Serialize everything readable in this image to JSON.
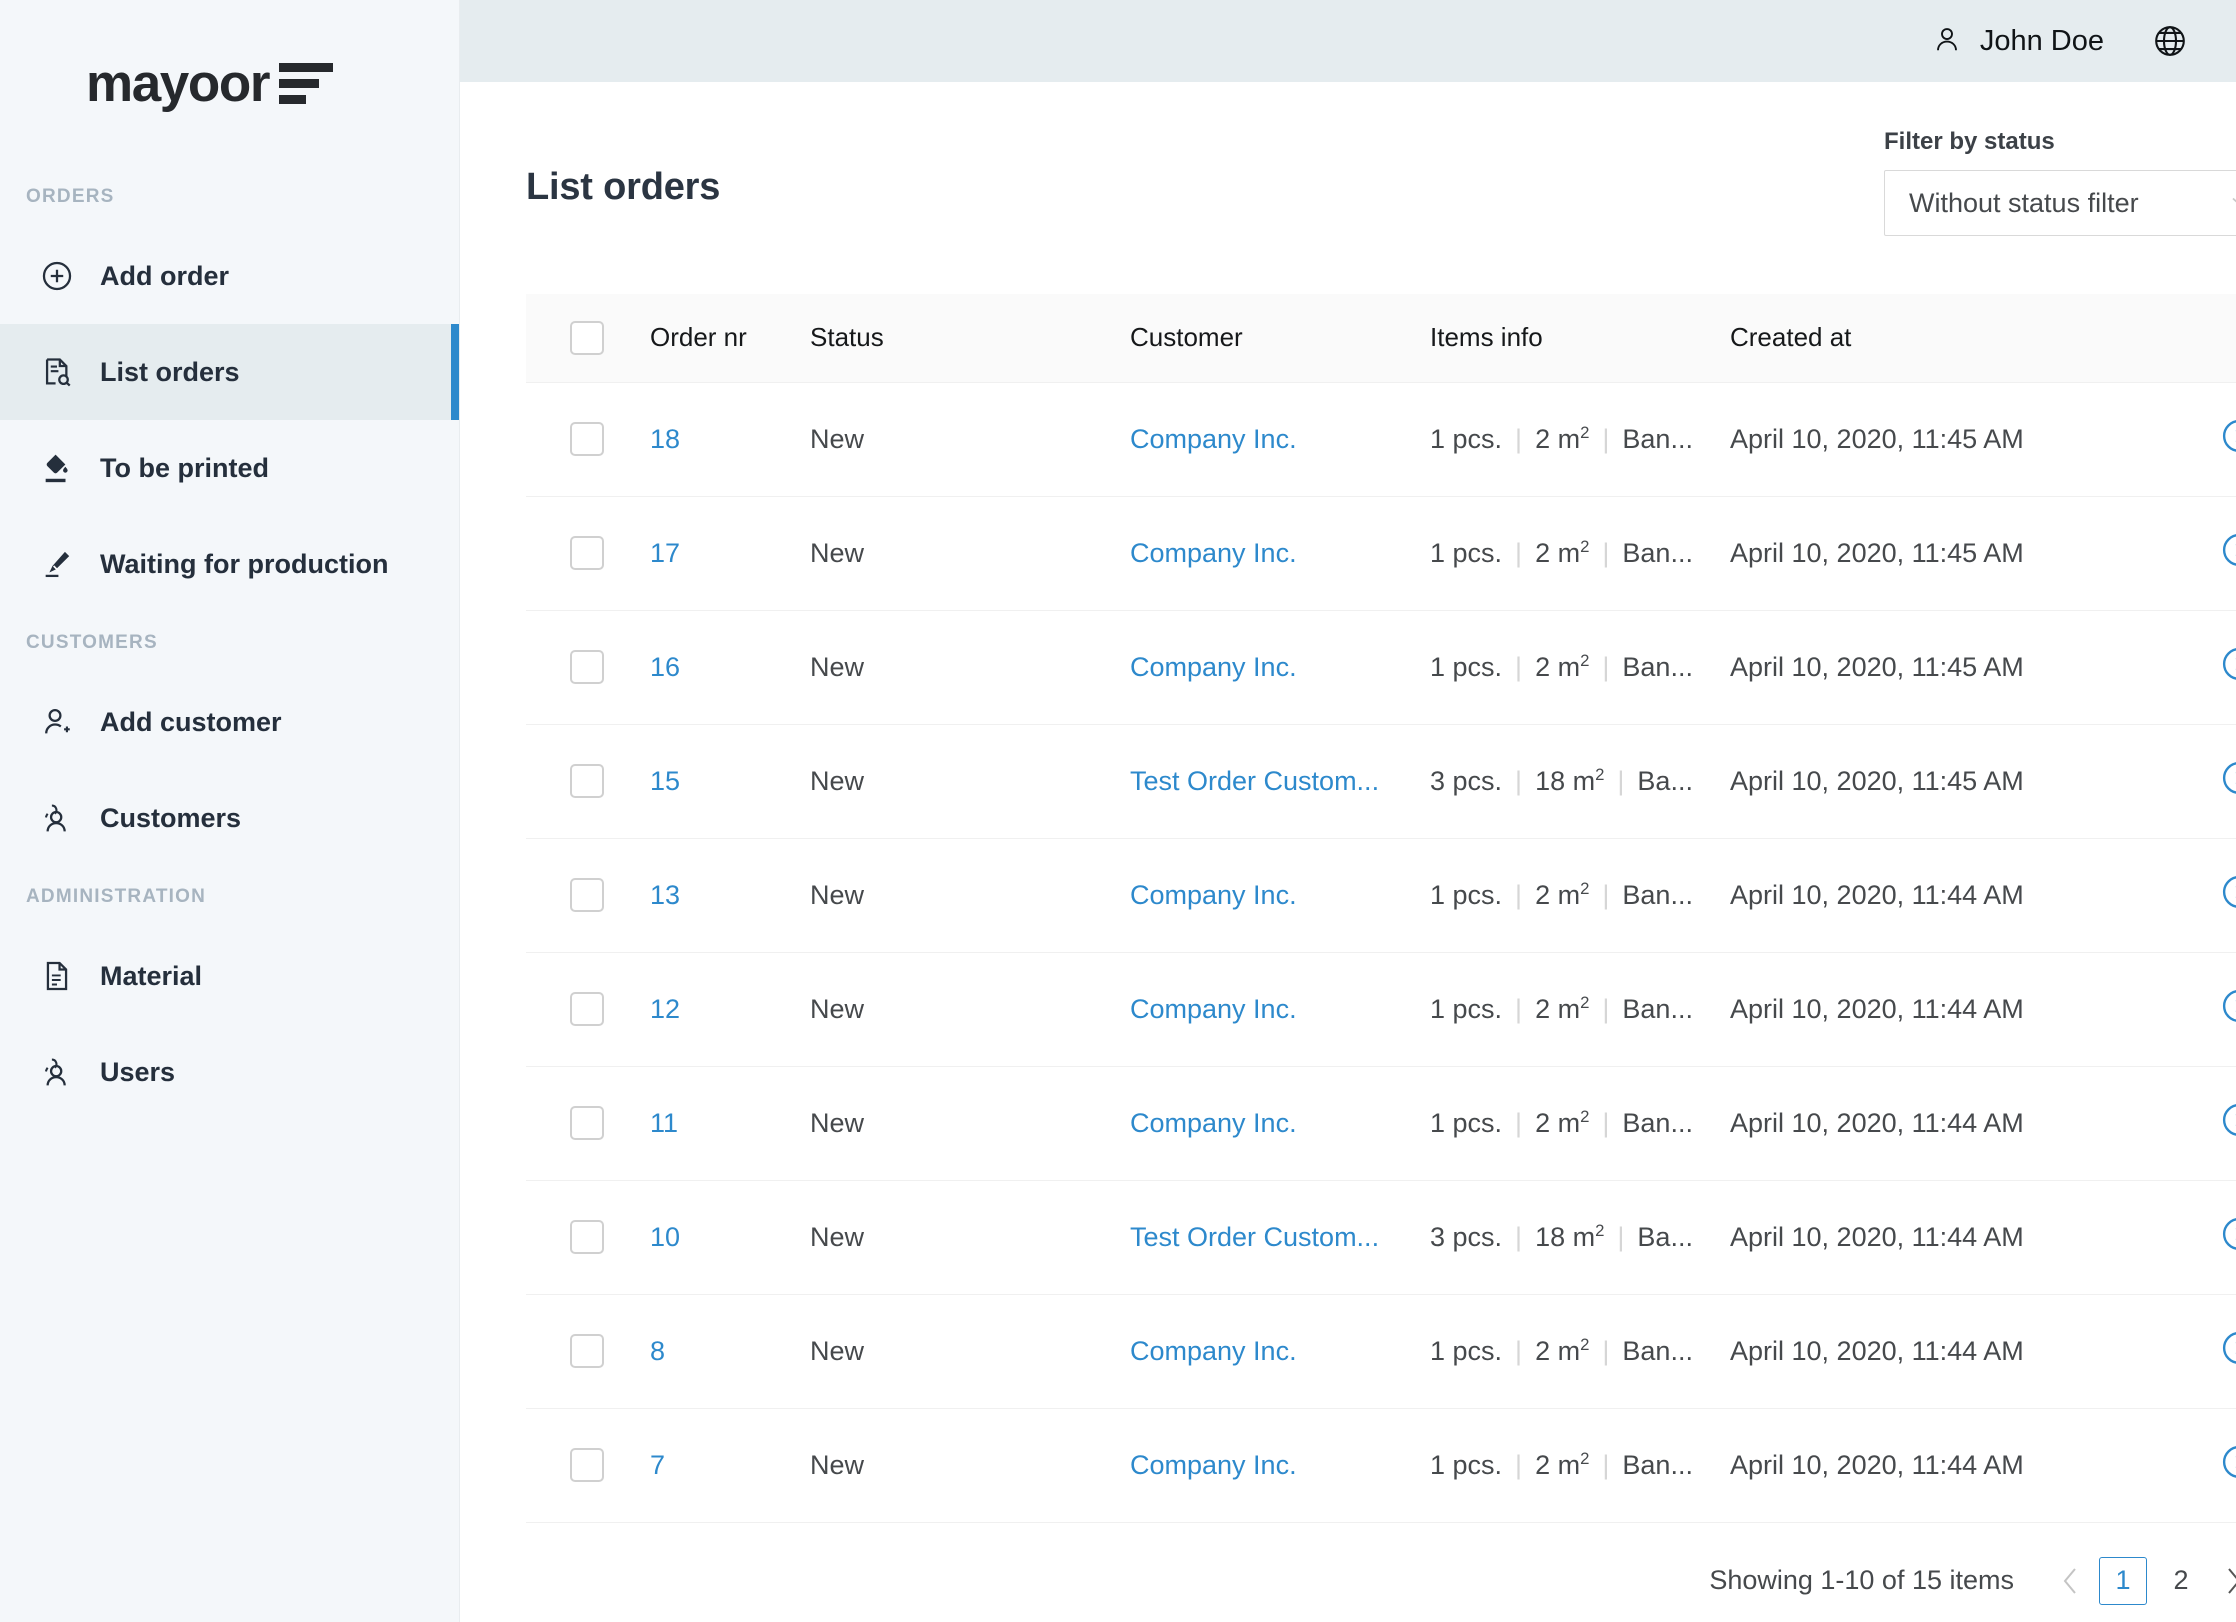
{
  "brand": {
    "name": "mayoor",
    "logo_icon": "bars-logo-icon"
  },
  "sidebar": {
    "sections": [
      {
        "title": "ORDERS",
        "items": [
          {
            "label": "Add order",
            "icon": "plus-circle-icon",
            "active": false
          },
          {
            "label": "List orders",
            "icon": "document-search-icon",
            "active": true
          },
          {
            "label": "To be printed",
            "icon": "paint-bucket-icon",
            "active": false
          },
          {
            "label": "Waiting for production",
            "icon": "marker-pen-icon",
            "active": false
          }
        ]
      },
      {
        "title": "CUSTOMERS",
        "items": [
          {
            "label": "Add customer",
            "icon": "user-plus-icon",
            "active": false
          },
          {
            "label": "Customers",
            "icon": "users-icon",
            "active": false
          }
        ]
      },
      {
        "title": "ADMINISTRATION",
        "items": [
          {
            "label": "Material",
            "icon": "file-document-icon",
            "active": false
          },
          {
            "label": "Users",
            "icon": "users-icon",
            "active": false
          }
        ]
      }
    ]
  },
  "topbar": {
    "user_icon": "person-icon",
    "user_name": "John Doe",
    "language_icon": "globe-icon",
    "logout_icon": "logout-icon"
  },
  "page": {
    "title": "List orders"
  },
  "filter": {
    "label": "Filter by status",
    "selected": "Without status filter",
    "chevron_icon": "chevron-down-icon"
  },
  "table": {
    "columns": [
      "Order nr",
      "Status",
      "Customer",
      "Items info",
      "Created at"
    ],
    "select_all_checkbox": "",
    "rows": [
      {
        "order_nr": "18",
        "status": "New",
        "customer": "Company Inc.",
        "pcs": "1 pcs.",
        "area": "2 m",
        "area_exp": "2",
        "material": "Ban...",
        "created_at": "April 10, 2020, 11:45 AM",
        "detail_icon": "chevron-right-circle-icon"
      },
      {
        "order_nr": "17",
        "status": "New",
        "customer": "Company Inc.",
        "pcs": "1 pcs.",
        "area": "2 m",
        "area_exp": "2",
        "material": "Ban...",
        "created_at": "April 10, 2020, 11:45 AM",
        "detail_icon": "chevron-right-circle-icon"
      },
      {
        "order_nr": "16",
        "status": "New",
        "customer": "Company Inc.",
        "pcs": "1 pcs.",
        "area": "2 m",
        "area_exp": "2",
        "material": "Ban...",
        "created_at": "April 10, 2020, 11:45 AM",
        "detail_icon": "chevron-right-circle-icon"
      },
      {
        "order_nr": "15",
        "status": "New",
        "customer": "Test Order Custom...",
        "pcs": "3 pcs.",
        "area": "18 m",
        "area_exp": "2",
        "material": "Ba...",
        "created_at": "April 10, 2020, 11:45 AM",
        "detail_icon": "chevron-right-circle-icon"
      },
      {
        "order_nr": "13",
        "status": "New",
        "customer": "Company Inc.",
        "pcs": "1 pcs.",
        "area": "2 m",
        "area_exp": "2",
        "material": "Ban...",
        "created_at": "April 10, 2020, 11:44 AM",
        "detail_icon": "chevron-right-circle-icon"
      },
      {
        "order_nr": "12",
        "status": "New",
        "customer": "Company Inc.",
        "pcs": "1 pcs.",
        "area": "2 m",
        "area_exp": "2",
        "material": "Ban...",
        "created_at": "April 10, 2020, 11:44 AM",
        "detail_icon": "chevron-right-circle-icon"
      },
      {
        "order_nr": "11",
        "status": "New",
        "customer": "Company Inc.",
        "pcs": "1 pcs.",
        "area": "2 m",
        "area_exp": "2",
        "material": "Ban...",
        "created_at": "April 10, 2020, 11:44 AM",
        "detail_icon": "chevron-right-circle-icon"
      },
      {
        "order_nr": "10",
        "status": "New",
        "customer": "Test Order Custom...",
        "pcs": "3 pcs.",
        "area": "18 m",
        "area_exp": "2",
        "material": "Ba...",
        "created_at": "April 10, 2020, 11:44 AM",
        "detail_icon": "chevron-right-circle-icon"
      },
      {
        "order_nr": "8",
        "status": "New",
        "customer": "Company Inc.",
        "pcs": "1 pcs.",
        "area": "2 m",
        "area_exp": "2",
        "material": "Ban...",
        "created_at": "April 10, 2020, 11:44 AM",
        "detail_icon": "chevron-right-circle-icon"
      },
      {
        "order_nr": "7",
        "status": "New",
        "customer": "Company Inc.",
        "pcs": "1 pcs.",
        "area": "2 m",
        "area_exp": "2",
        "material": "Ban...",
        "created_at": "April 10, 2020, 11:44 AM",
        "detail_icon": "chevron-right-circle-icon"
      }
    ]
  },
  "pagination": {
    "showing": "Showing 1-10 of 15 items",
    "prev_icon": "chevron-left-icon",
    "next_icon": "chevron-right-icon",
    "pages": [
      "1",
      "2"
    ],
    "active_page": "1"
  },
  "colors": {
    "accent": "#2d89cc",
    "sidebar_bg": "#f4f7fa",
    "topbar_bg": "#e5ecef",
    "active_item_bg": "#e5ecef",
    "text_dark": "#252f3c",
    "text_muted": "#46494c",
    "section_title": "#a7b4c0"
  }
}
